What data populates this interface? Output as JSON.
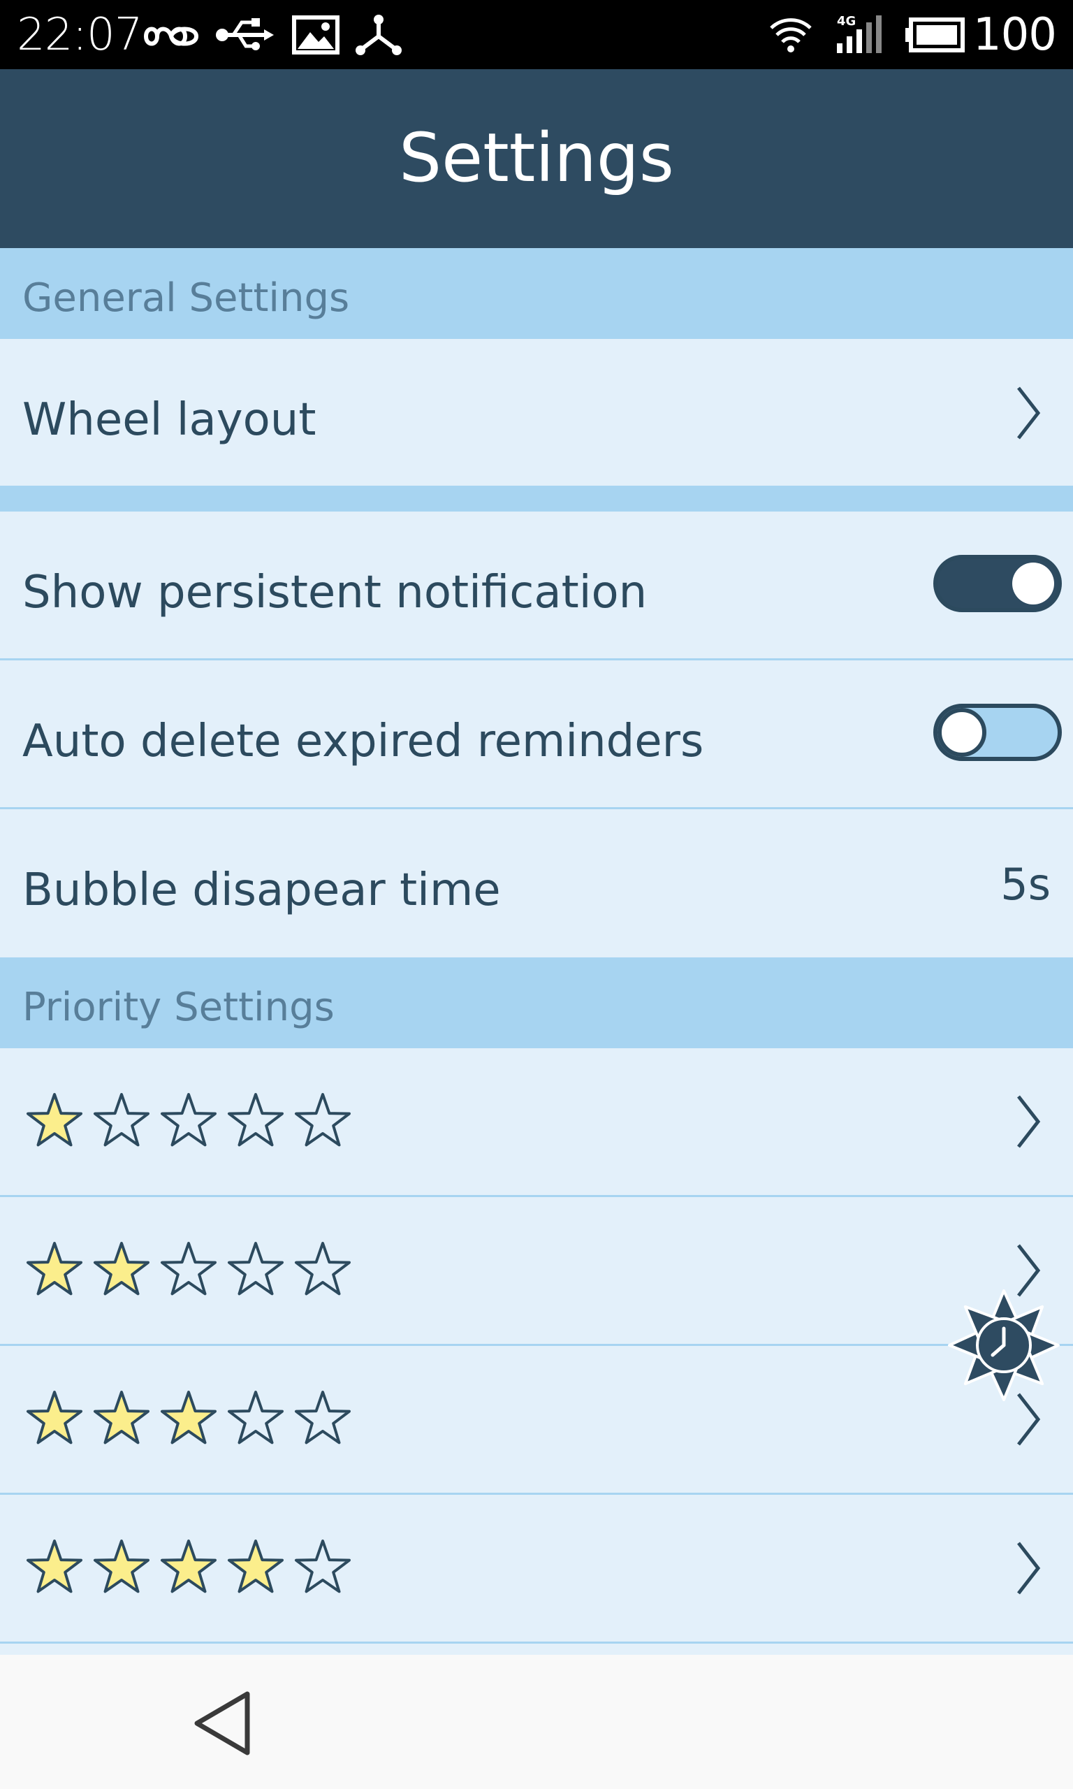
{
  "status_bar": {
    "time": "22:07",
    "icons_left": [
      "infinity-icon",
      "usb-icon",
      "image-icon",
      "share-icon"
    ],
    "icons_right": [
      "wifi-icon",
      "signal-4g-icon",
      "battery-icon"
    ],
    "battery": "100"
  },
  "app_bar": {
    "title": "Settings"
  },
  "general_settings": {
    "header": "General Settings",
    "wheel_layout": "Wheel layout",
    "show_persistent_notification": {
      "label": "Show persistent notification",
      "enabled": true
    },
    "auto_delete_expired_reminders": {
      "label": "Auto delete expired reminders",
      "enabled": false
    },
    "bubble_disappear_time": {
      "label": "Bubble disapear time",
      "value": "5s"
    }
  },
  "priority_settings": {
    "header": "Priority Settings",
    "levels": [
      {
        "filled": 1,
        "total": 5
      },
      {
        "filled": 2,
        "total": 5
      },
      {
        "filled": 3,
        "total": 5
      },
      {
        "filled": 4,
        "total": 5
      }
    ]
  },
  "colors": {
    "app_bar": "#2e4b61",
    "section_header": "#a7d4f1",
    "row_background": "#e3f0fa",
    "text_primary": "#2c4a5e",
    "star_fill": "#fbee8c"
  },
  "navigation": {
    "back_icon": "back-triangle-icon"
  }
}
